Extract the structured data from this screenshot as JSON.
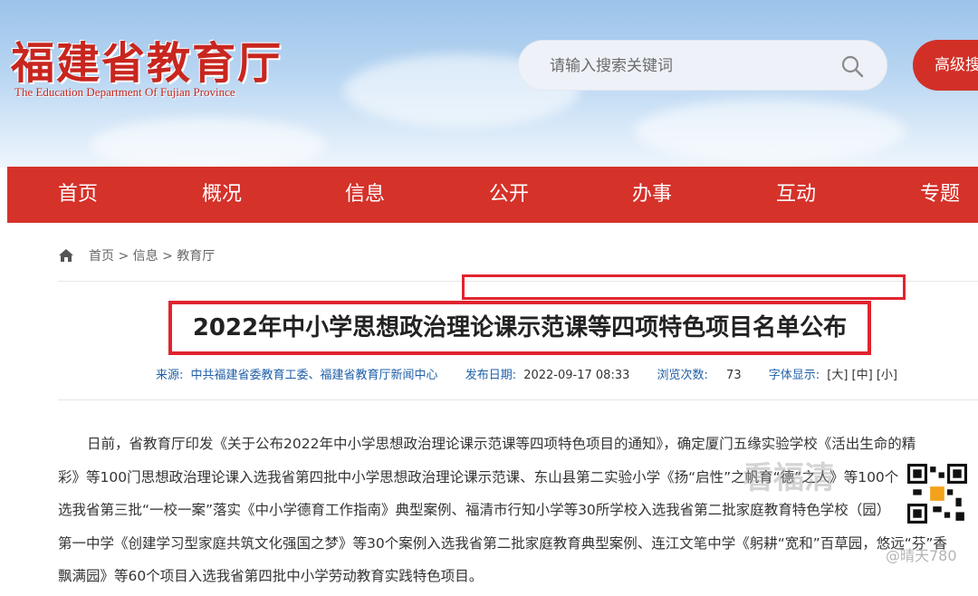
{
  "header": {
    "logo_cn": "福建省教育厅",
    "logo_en": "The Education Department Of Fujian Province",
    "search_placeholder": "请输入搜索关键词",
    "advanced_search": "高级搜"
  },
  "nav": [
    "首页",
    "概况",
    "信息",
    "公开",
    "办事",
    "互动",
    "专题"
  ],
  "breadcrumb": "首页 > 信息 > 教育厅",
  "article": {
    "title": "2022年中小学思想政治理论课示范课等四项特色项目名单公布",
    "source_label": "来源:",
    "source": "中共福建省委教育工委、福建省教育厅新闻中心",
    "date_label": "发布日期:",
    "date": "2022-09-17 08:33",
    "views_label": "浏览次数:",
    "views": "73",
    "font_label": "字体显示:",
    "font_sizes": "[大] [中] [小]",
    "lines": [
      "日前，省教育厅印发《关于公布2022年中小学思想政治理论课示范课等四项特色项目的通知》，确定厦门五缘实验学校《活出生命的精",
      "彩》等100门思想政治理论课入选我省第四批中小学思想政治理论课示范课、东山县第二实验小学《扬“启性”之帆育“德”之人》等100个",
      "选我省第三批“一校一案”落实《中小学德育工作指南》典型案例、福清市行知小学等30所学校入选我省第二批家庭教育特色学校（园）",
      "第一中学《创建学习型家庭共筑文化强国之梦》等30个案例入选我省第二批家庭教育典型案例、连江文笔中学《躬耕“宽和”百草园，悠远“芬”香",
      "飘满园》等60个项目入选我省第四批中小学劳动教育实践特色项目。"
    ]
  },
  "watermark": {
    "main": "看福清",
    "sub": "@晴天780"
  }
}
